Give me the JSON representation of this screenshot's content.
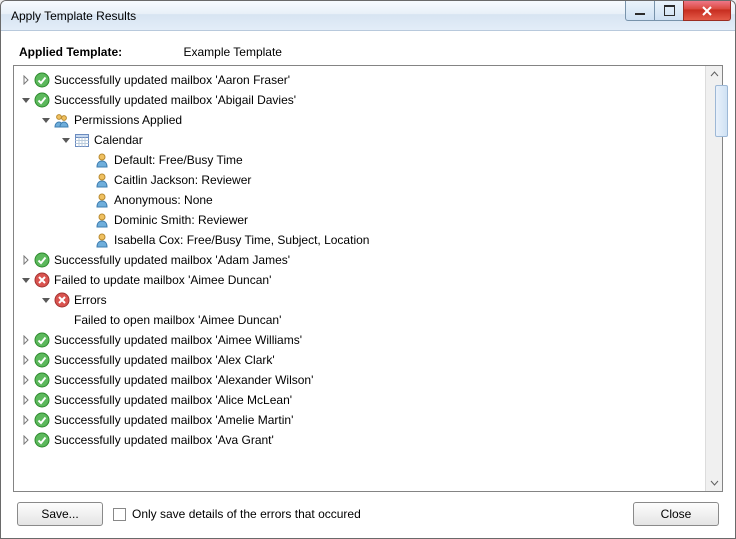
{
  "window": {
    "title": "Apply Template Results"
  },
  "header": {
    "label": "Applied Template:",
    "template_name": "Example Template"
  },
  "tree": [
    {
      "icon": "success",
      "expand": "closed",
      "text": "Successfully updated mailbox 'Aaron Fraser'"
    },
    {
      "icon": "success",
      "expand": "open",
      "text": "Successfully updated mailbox 'Abigail Davies'",
      "children": [
        {
          "icon": "permissions",
          "expand": "open",
          "text": "Permissions Applied",
          "children": [
            {
              "icon": "calendar",
              "expand": "open",
              "text": "Calendar",
              "children": [
                {
                  "icon": "user",
                  "expand": "none",
                  "text": "Default: Free/Busy Time"
                },
                {
                  "icon": "user",
                  "expand": "none",
                  "text": "Caitlin Jackson: Reviewer"
                },
                {
                  "icon": "user",
                  "expand": "none",
                  "text": "Anonymous: None"
                },
                {
                  "icon": "user",
                  "expand": "none",
                  "text": "Dominic Smith: Reviewer"
                },
                {
                  "icon": "user",
                  "expand": "none",
                  "text": "Isabella Cox: Free/Busy Time, Subject, Location"
                }
              ]
            }
          ]
        }
      ]
    },
    {
      "icon": "success",
      "expand": "closed",
      "text": "Successfully updated mailbox 'Adam James'"
    },
    {
      "icon": "error",
      "expand": "open",
      "text": "Failed to update mailbox 'Aimee Duncan'",
      "children": [
        {
          "icon": "error",
          "expand": "open",
          "text": "Errors",
          "children": [
            {
              "icon": "none",
              "expand": "none",
              "text": "Failed to open mailbox 'Aimee Duncan'"
            }
          ]
        }
      ]
    },
    {
      "icon": "success",
      "expand": "closed",
      "text": "Successfully updated mailbox 'Aimee Williams'"
    },
    {
      "icon": "success",
      "expand": "closed",
      "text": "Successfully updated mailbox 'Alex Clark'"
    },
    {
      "icon": "success",
      "expand": "closed",
      "text": "Successfully updated mailbox 'Alexander Wilson'"
    },
    {
      "icon": "success",
      "expand": "closed",
      "text": "Successfully updated mailbox 'Alice McLean'"
    },
    {
      "icon": "success",
      "expand": "closed",
      "text": "Successfully updated mailbox 'Amelie Martin'"
    },
    {
      "icon": "success",
      "expand": "closed",
      "text": "Successfully updated mailbox 'Ava Grant'"
    }
  ],
  "footer": {
    "save_label": "Save...",
    "checkbox_label": "Only save details of the errors that occured",
    "close_label": "Close"
  }
}
